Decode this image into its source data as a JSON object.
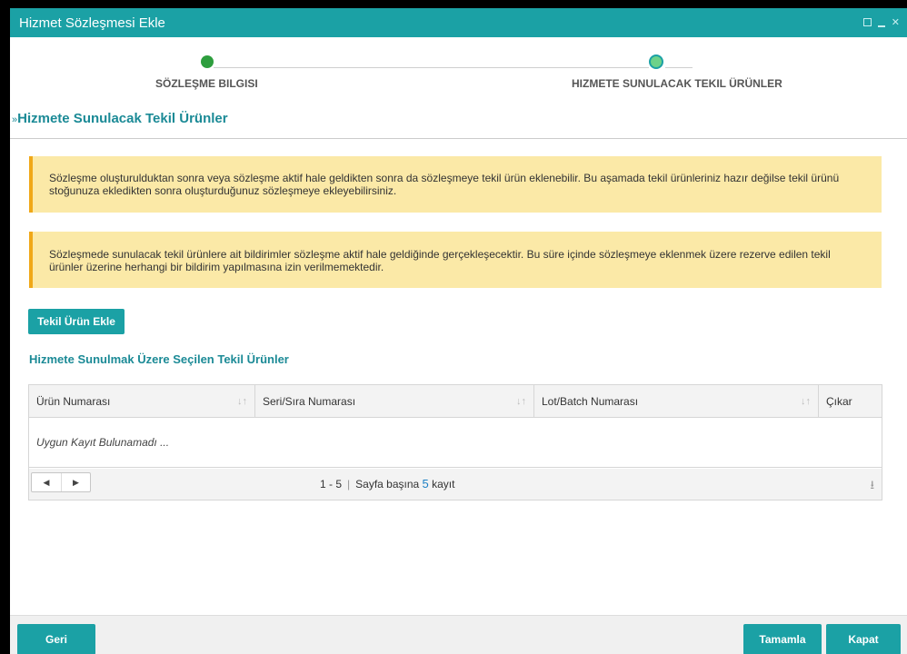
{
  "window": {
    "title": "Hizmet Sözleşmesi Ekle"
  },
  "wizard": {
    "steps": [
      {
        "label": "SÖZLEŞME BILGISI",
        "status": "done"
      },
      {
        "label": "HIZMETE SUNULACAK TEKIL ÜRÜNLER",
        "status": "active"
      }
    ]
  },
  "section": {
    "title": "Hizmete Sunulacak Tekil Ürünler"
  },
  "alerts": [
    "Sözleşme oluşturulduktan sonra veya sözleşme aktif hale geldikten sonra da sözleşmeye tekil ürün eklenebilir. Bu aşamada tekil ürünleriniz hazır değilse tekil ürünü stoğunuza ekledikten sonra oluşturduğunuz sözleşmeye ekleyebilirsiniz.",
    "Sözleşmede sunulacak tekil ürünlere ait bildirimler sözleşme aktif hale geldiğinde gerçekleşecektir. Bu süre içinde sözleşmeye eklenmek üzere rezerve edilen tekil ürünler üzerine herhangi bir bildirim yapılmasına izin verilmemektedir."
  ],
  "add_button": "Tekil Ürün Ekle",
  "grid": {
    "title": "Hizmete Sunulmak Üzere Seçilen Tekil Ürünler",
    "columns": [
      "Ürün Numarası",
      "Seri/Sıra Numarası",
      "Lot/Batch Numarası",
      "Çıkar"
    ],
    "empty_text": "Uygun Kayıt Bulunamadı ...",
    "range": "1 - 5",
    "page_size_prefix": "Sayfa başına",
    "page_size": "5",
    "page_size_suffix": "kayıt"
  },
  "footer": {
    "back": "Geri",
    "finish": "Tamamla",
    "close": "Kapat"
  },
  "colors": {
    "accent": "#1ba1a5",
    "alert_bg": "#fbe9a7",
    "alert_border": "#f0a818",
    "step_done": "#2e9e3e",
    "step_active": "#6dd28a"
  }
}
